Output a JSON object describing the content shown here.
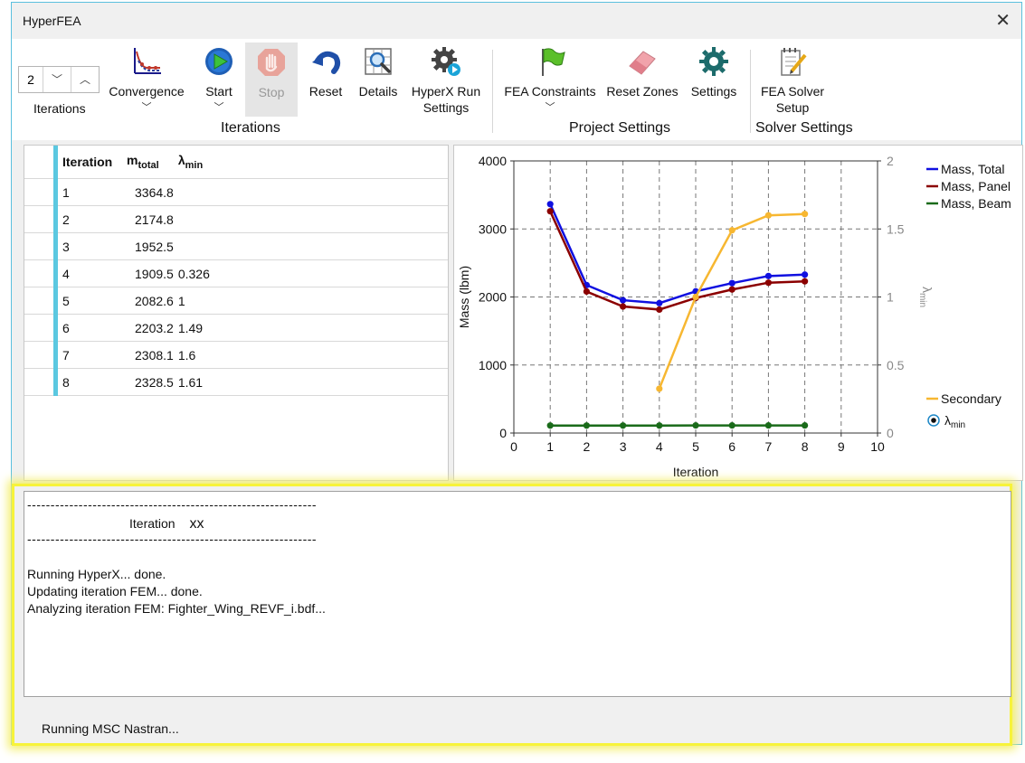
{
  "window": {
    "title": "HyperFEA",
    "close_glyph": "✕"
  },
  "ribbon": {
    "stepper": {
      "value": "2",
      "down_glyph": "⌄",
      "up_glyph": "⌃",
      "caption": "Iterations"
    },
    "buttons": {
      "convergence": {
        "label": "Convergence",
        "icon": "convergence-chart-icon"
      },
      "start": {
        "label": "Start",
        "icon": "play-icon"
      },
      "stop": {
        "label": "Stop",
        "icon": "stop-hand-icon"
      },
      "reset": {
        "label": "Reset",
        "icon": "undo-icon"
      },
      "details": {
        "label": "Details",
        "icon": "magnifier-grid-icon"
      },
      "hyperx_run_settings": {
        "label1": "HyperX Run",
        "label2": "Settings",
        "icon": "gear-play-icon"
      },
      "fea_constraints": {
        "label": "FEA Constraints",
        "icon": "green-flag-icon"
      },
      "reset_zones": {
        "label": "Reset Zones",
        "icon": "eraser-icon"
      },
      "settings": {
        "label": "Settings",
        "icon": "gear-icon"
      },
      "fea_solver_setup": {
        "label1": "FEA Solver",
        "label2": "Setup",
        "icon": "notepad-pencil-icon"
      }
    },
    "groups": {
      "iterations": "Iterations",
      "project_settings": "Project Settings",
      "solver_settings": "Solver Settings"
    }
  },
  "table": {
    "headers": {
      "iteration": "Iteration",
      "mtotal": "m",
      "mtotal_sub": "total",
      "lambda": "λ",
      "lambda_sub": "min"
    },
    "rows": [
      {
        "iteration": "1",
        "mtotal": "3364.8",
        "lambda": ""
      },
      {
        "iteration": "2",
        "mtotal": "2174.8",
        "lambda": ""
      },
      {
        "iteration": "3",
        "mtotal": "1952.5",
        "lambda": ""
      },
      {
        "iteration": "4",
        "mtotal": "1909.5",
        "lambda": "0.326"
      },
      {
        "iteration": "5",
        "mtotal": "2082.6",
        "lambda": "1"
      },
      {
        "iteration": "6",
        "mtotal": "2203.2",
        "lambda": "1.49"
      },
      {
        "iteration": "7",
        "mtotal": "2308.1",
        "lambda": "1.6"
      },
      {
        "iteration": "8",
        "mtotal": "2328.5",
        "lambda": "1.61"
      }
    ]
  },
  "chart_data": {
    "type": "line",
    "xlabel": "Iteration",
    "ylabel": "Mass (lbm)",
    "y2label": "λ",
    "y2label_sub": "min",
    "xlim": [
      0,
      10
    ],
    "ylim": [
      0,
      4000
    ],
    "y2lim": [
      0,
      2
    ],
    "xticks": [
      0,
      1,
      2,
      3,
      4,
      5,
      6,
      7,
      8,
      9,
      10
    ],
    "yticks": [
      0,
      1000,
      2000,
      3000,
      4000
    ],
    "y2ticks": [
      0,
      0.5,
      1,
      1.5,
      2
    ],
    "y2ticklabels": [
      "0",
      "0.5",
      "1",
      "1.5",
      "2"
    ],
    "grid": true,
    "legend_position": "right",
    "series": [
      {
        "name": "Mass, Total",
        "color": "#1010e0",
        "axis": "y",
        "x": [
          1,
          2,
          3,
          4,
          5,
          6,
          7,
          8
        ],
        "values": [
          3364.8,
          2174.8,
          1952.5,
          1909.5,
          2082.6,
          2203.2,
          2308.1,
          2328.5
        ]
      },
      {
        "name": "Mass, Panel",
        "color": "#8b0000",
        "axis": "y",
        "x": [
          1,
          2,
          3,
          4,
          5,
          6,
          7,
          8
        ],
        "values": [
          3260,
          2080,
          1860,
          1815,
          1985,
          2110,
          2210,
          2230
        ]
      },
      {
        "name": "Mass, Beam",
        "color": "#1a6b1a",
        "axis": "y",
        "x": [
          1,
          2,
          3,
          4,
          5,
          6,
          7,
          8
        ],
        "values": [
          110,
          110,
          110,
          110,
          112,
          112,
          112,
          112
        ]
      },
      {
        "name": "Secondary",
        "color": "#f7b731",
        "axis": "y2",
        "x": [
          4,
          5,
          6,
          7,
          8
        ],
        "values": [
          0.326,
          1,
          1.49,
          1.6,
          1.61
        ]
      }
    ],
    "secondary_legend": {
      "name": "Secondary",
      "radio_label": "λ",
      "radio_sub": "min"
    }
  },
  "log": {
    "dash_line": "--------------------------------------------------------------",
    "iteration_label": "Iteration",
    "iteration_value": "xx",
    "lines": [
      "Running HyperX... done.",
      "Updating iteration FEM... done.",
      "Analyzing iteration FEM: Fighter_Wing_REVF_i.bdf..."
    ]
  },
  "status": {
    "text": "Running MSC Nastran..."
  }
}
